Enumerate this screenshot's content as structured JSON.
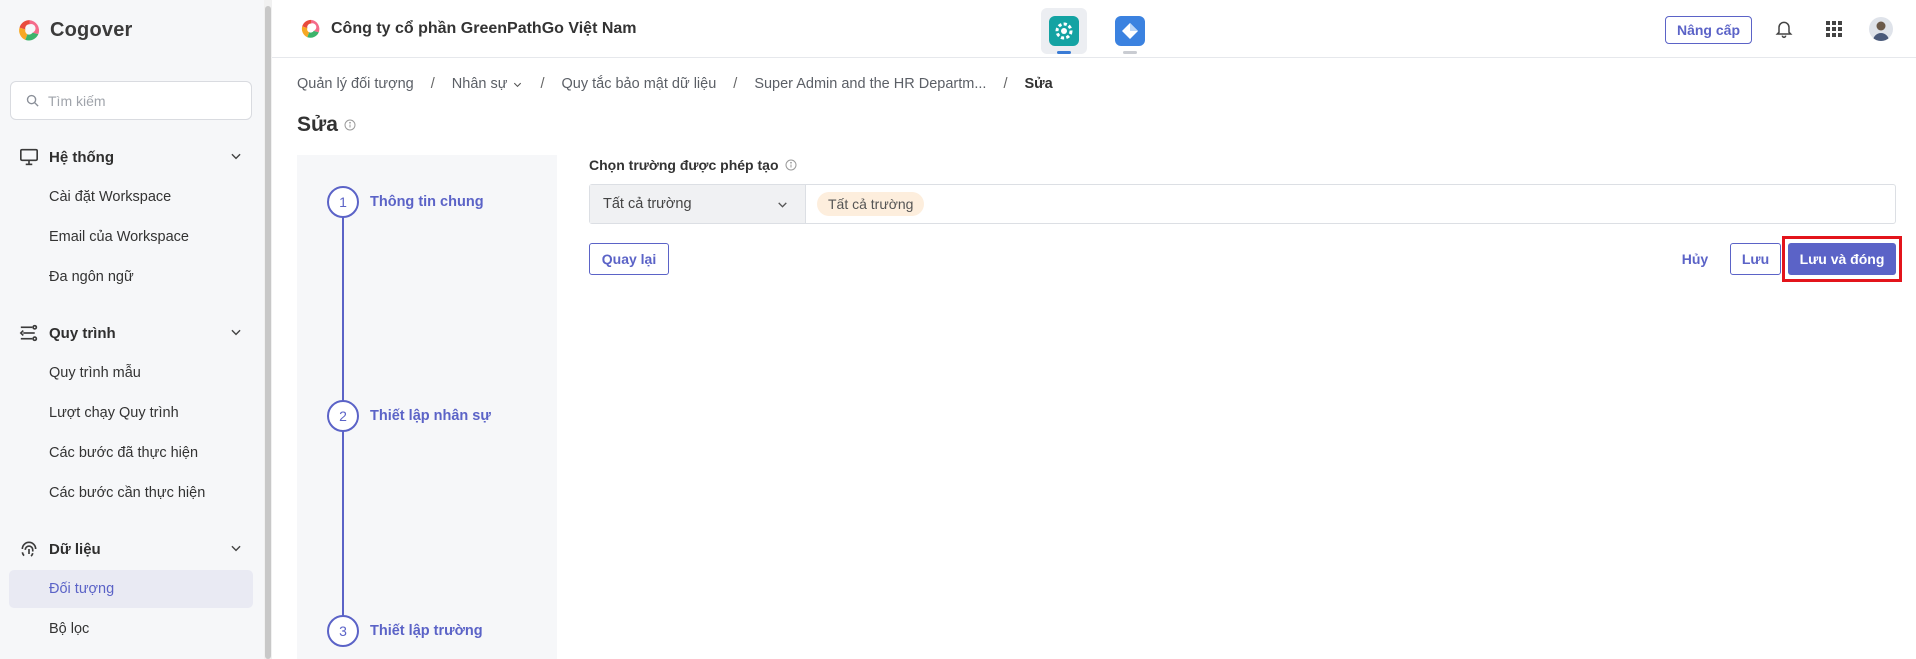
{
  "sidebar": {
    "logo_text": "Cogover",
    "search_placeholder": "Tìm kiếm",
    "groups": [
      {
        "label": "Hệ thống",
        "icon": "monitor-icon",
        "items": [
          {
            "label": "Cài đặt Workspace"
          },
          {
            "label": "Email của Workspace"
          },
          {
            "label": "Đa ngôn ngữ"
          }
        ]
      },
      {
        "label": "Quy trình",
        "icon": "workflow-icon",
        "items": [
          {
            "label": "Quy trình mẫu"
          },
          {
            "label": "Lượt chạy Quy trình"
          },
          {
            "label": "Các bước đã thực hiện"
          },
          {
            "label": "Các bước cần thực hiện"
          }
        ]
      },
      {
        "label": "Dữ liệu",
        "icon": "fingerprint-icon",
        "items": [
          {
            "label": "Đối tượng",
            "active": true
          },
          {
            "label": "Bộ lọc"
          }
        ]
      }
    ]
  },
  "topbar": {
    "company_name": "Công ty cổ phần GreenPathGo Việt Nam",
    "app_tabs": [
      {
        "icon": "settings-app-icon",
        "active": true
      },
      {
        "icon": "diamond-app-icon",
        "active": false
      }
    ],
    "upgrade_label": "Nâng cấp",
    "icons": [
      "bell-icon",
      "grid-apps-icon",
      "user-avatar"
    ]
  },
  "breadcrumb": [
    "Quản lý đối tượng",
    "Nhân sự",
    "Quy tắc bảo mật dữ liệu",
    "Super Admin and the HR Departm...",
    "Sửa"
  ],
  "page_title": "Sửa",
  "steps": [
    {
      "number": "1",
      "label": "Thông tin chung"
    },
    {
      "number": "2",
      "label": "Thiết lập nhân sự"
    },
    {
      "number": "3",
      "label": "Thiết lập trường"
    }
  ],
  "form": {
    "field_label": "Chọn trường được phép tạo",
    "select_value": "Tất cả trường",
    "tag": "Tất cả trường"
  },
  "buttons": {
    "back": "Quay lại",
    "cancel": "Hủy",
    "save": "Lưu",
    "save_close": "Lưu và đóng"
  },
  "colors": {
    "accent": "#5b63c7",
    "highlight": "#e3141b",
    "tag_bg": "#fdeedd"
  }
}
